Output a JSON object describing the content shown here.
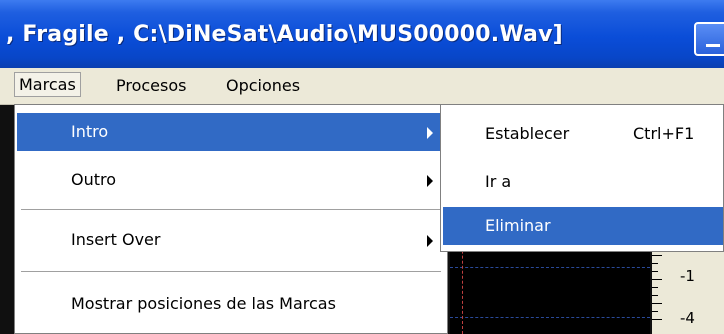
{
  "window": {
    "title": ", Fragile , C:\\DiNeSat\\Audio\\MUS00000.Wav]",
    "title_bar_color": "#0a4dd8"
  },
  "menubar": {
    "items": [
      {
        "label": "Marcas",
        "open": true
      },
      {
        "label": "Procesos"
      },
      {
        "label": "Opciones"
      }
    ]
  },
  "marcas_menu": {
    "items": [
      {
        "label": "Intro",
        "has_submenu": true,
        "highlighted": true
      },
      {
        "label": "Outro",
        "has_submenu": true
      },
      {
        "label": "Insert Over",
        "has_submenu": true
      },
      {
        "label": "Mostrar posiciones de las Marcas",
        "has_submenu": false
      }
    ],
    "highlight_color": "#316ac5"
  },
  "intro_submenu": {
    "items": [
      {
        "label": "Establecer",
        "shortcut": "Ctrl+F1"
      },
      {
        "label": "Ir a",
        "shortcut": ""
      },
      {
        "label": "Eliminar",
        "shortcut": "",
        "highlighted": true
      }
    ]
  },
  "ruler": {
    "labels": [
      "-1",
      "-4"
    ]
  }
}
